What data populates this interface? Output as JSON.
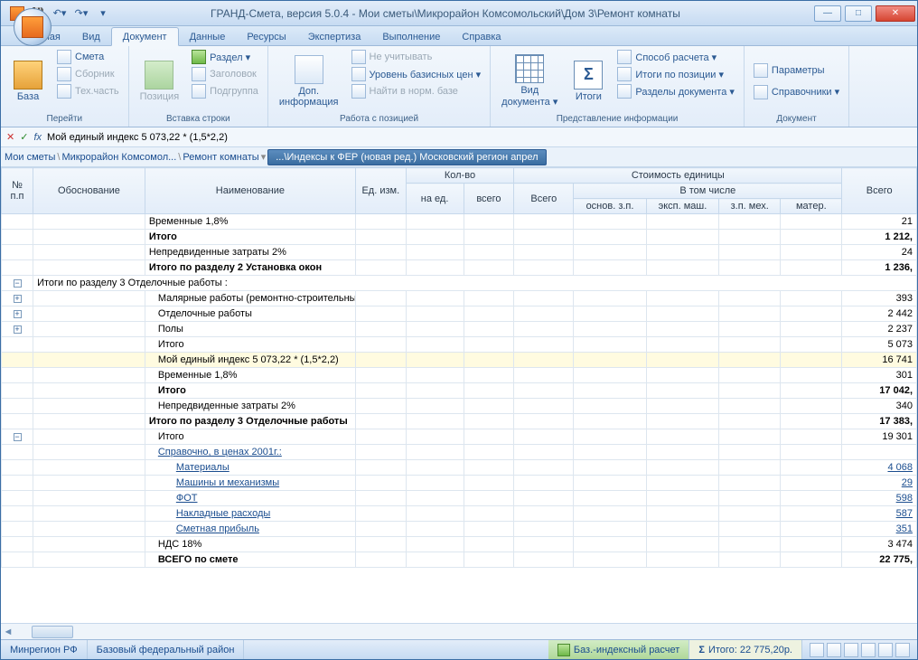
{
  "title": "ГРАНД-Смета, версия 5.0.4 - Мои сметы\\Микрорайон Комсомольский\\Дом 3\\Ремонт комнаты",
  "tabs": [
    "Главная",
    "Вид",
    "Документ",
    "Данные",
    "Ресурсы",
    "Экспертиза",
    "Выполнение",
    "Справка"
  ],
  "activeTab": 2,
  "ribbon": {
    "g1": {
      "label": "Перейти",
      "big": "База",
      "items": [
        "Смета",
        "Сборник",
        "Тех.часть"
      ]
    },
    "g2": {
      "label": "Вставка строки",
      "big": "Позиция",
      "items": [
        "Раздел ▾",
        "Заголовок",
        "Подгруппа"
      ]
    },
    "g3": {
      "label": "Работа с позицией",
      "big": "Доп.\nинформация",
      "items": [
        "Не учитывать",
        "Уровень базисных цен ▾",
        "Найти в норм. базе"
      ]
    },
    "g4": {
      "label": "Представление информации",
      "big1": "Вид\nдокумента ▾",
      "big2": "Итоги",
      "items": [
        "Способ расчета ▾",
        "Итоги по позиции ▾",
        "Разделы документа ▾"
      ]
    },
    "g5": {
      "label": "Документ",
      "items": [
        "Параметры",
        "Справочники ▾"
      ]
    }
  },
  "formula": "Мой единый индекс 5 073,22 * (1,5*2,2)",
  "breadcrumb": {
    "parts": [
      "Мои сметы",
      "Микрорайон Комсомол...",
      "Ремонт комнаты"
    ],
    "tab": "...\\Индексы к ФЕР (новая ред.) Московский регион апрел"
  },
  "headers": {
    "nn": "№\nп.п",
    "obos": "Обоснование",
    "naim": "Наименование",
    "ed": "Ед. изм.",
    "kolvo": "Кол-во",
    "k1": "на ед.",
    "k2": "всего",
    "stoim": "Стоимость единицы",
    "s1": "Всего",
    "vtom": "В том числе",
    "s2": "основ. з.п.",
    "s3": "эксп. маш.",
    "s4": "з.п. мех.",
    "s5": "матер.",
    "total": "Всего"
  },
  "rows": [
    {
      "tree": "",
      "name": "Временные 1,8%",
      "total": "21"
    },
    {
      "tree": "",
      "name": "Итого",
      "total": "1 212,",
      "bold": true
    },
    {
      "tree": "",
      "name": "Непредвиденные затраты 2%",
      "total": "24"
    },
    {
      "tree": "",
      "name": "Итого по разделу 2 Установка окон",
      "total": "1 236,",
      "bold": true
    },
    {
      "tree": "-",
      "obspan": "Итоги по разделу 3 Отделочные работы :"
    },
    {
      "tree": "+",
      "name": "Малярные работы (ремонтно-строительные)",
      "total": "393",
      "indent": 1
    },
    {
      "tree": "+",
      "name": "Отделочные работы",
      "total": "2 442",
      "indent": 1
    },
    {
      "tree": "+",
      "name": "Полы",
      "total": "2 237",
      "indent": 1
    },
    {
      "tree": "",
      "name": "Итого",
      "total": "5 073",
      "indent": 1
    },
    {
      "tree": "",
      "name": "Мой единый индекс 5 073,22 * (1,5*2,2)",
      "total": "16 741",
      "indent": 1,
      "hl": true
    },
    {
      "tree": "",
      "name": "Временные 1,8%",
      "total": "301",
      "indent": 1
    },
    {
      "tree": "",
      "name": "Итого",
      "total": "17 042,",
      "bold": true,
      "indent": 1
    },
    {
      "tree": "",
      "name": "Непредвиденные затраты 2%",
      "total": "340",
      "indent": 1
    },
    {
      "tree": "",
      "name": "Итого по разделу 3 Отделочные работы",
      "total": "17 383,",
      "bold": true
    },
    {
      "tree": "-",
      "name": "Итого",
      "total": "19 301",
      "indent": 1
    },
    {
      "tree": "",
      "name": "Справочно, в ценах 2001г.:",
      "link": true,
      "indent": 1
    },
    {
      "tree": "",
      "name": "Материалы",
      "total": "4 068",
      "link": true,
      "indent": 2
    },
    {
      "tree": "",
      "name": "Машины и механизмы",
      "total": "29",
      "link": true,
      "indent": 2
    },
    {
      "tree": "",
      "name": "ФОТ",
      "total": "598",
      "link": true,
      "indent": 2
    },
    {
      "tree": "",
      "name": "Накладные расходы",
      "total": "587",
      "link": true,
      "indent": 2
    },
    {
      "tree": "",
      "name": "Сметная прибыль",
      "total": "351",
      "link": true,
      "indent": 2
    },
    {
      "tree": "",
      "name": "НДС 18%",
      "total": "3 474",
      "indent": 1
    },
    {
      "tree": "",
      "name": "ВСЕГО по смете",
      "total": "22 775,",
      "bold": true,
      "indent": 1
    }
  ],
  "status": {
    "left1": "Минрегион РФ",
    "left2": "Базовый федеральный район",
    "calc": "Баз.-индексный расчет",
    "total": "Итого: 22 775,20р."
  }
}
